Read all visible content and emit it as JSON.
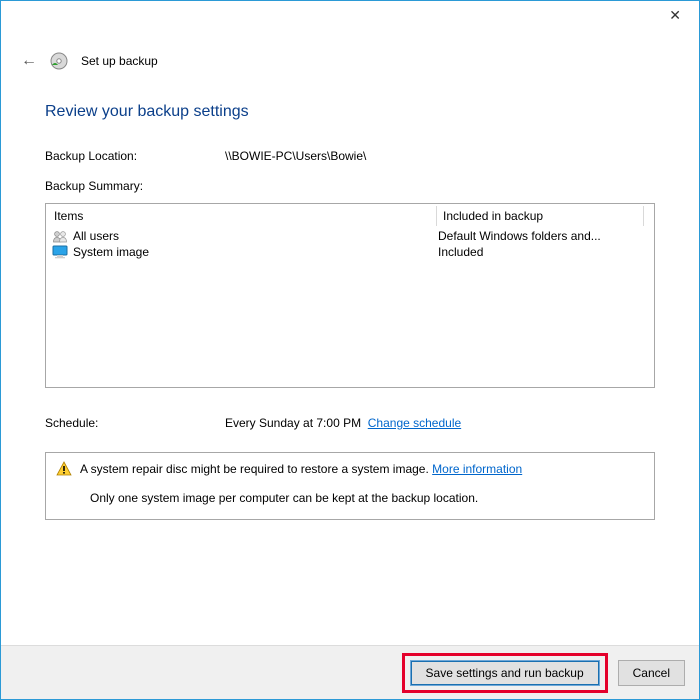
{
  "header": {
    "title": "Set up backup"
  },
  "page": {
    "heading": "Review your backup settings",
    "backup_location_label": "Backup Location:",
    "backup_location_value": "\\\\BOWIE-PC\\Users\\Bowie\\",
    "backup_summary_label": "Backup Summary:",
    "table_headers": {
      "items": "Items",
      "included": "Included in backup"
    },
    "rows": [
      {
        "item": "All users",
        "included": "Default Windows folders and..."
      },
      {
        "item": "System image",
        "included": "Included"
      }
    ],
    "schedule_label": "Schedule:",
    "schedule_value": "Every Sunday at 7:00 PM",
    "change_schedule": "Change schedule",
    "info": {
      "line1": "A system repair disc might be required to restore a system image.",
      "more_info": "More information",
      "line2": "Only one system image per computer can be kept at the backup location."
    }
  },
  "footer": {
    "primary": "Save settings and run backup",
    "cancel": "Cancel"
  }
}
